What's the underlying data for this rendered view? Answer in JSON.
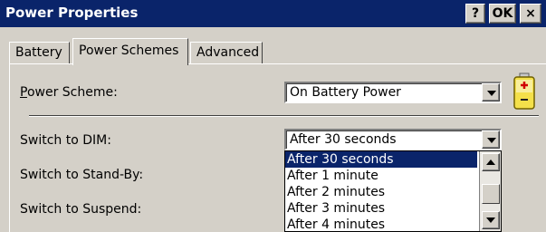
{
  "window": {
    "title": "Power Properties",
    "help_label": "?",
    "ok_label": "OK",
    "close_label": "×",
    "title_bar_color": "#0a246a"
  },
  "tabs": [
    {
      "label": "Battery",
      "active": false
    },
    {
      "label": "Power Schemes",
      "active": true
    },
    {
      "label": "Advanced",
      "active": false
    }
  ],
  "power_scheme": {
    "label_prefix": "",
    "label_accel": "P",
    "label_rest": "ower Scheme:",
    "value": "On Battery Power",
    "icon": "battery-icon"
  },
  "settings": {
    "dim_label": "Switch to DIM:",
    "dim_value": "After 30 seconds",
    "standby_label": "Switch to Stand-By:",
    "suspend_label": "Switch to Suspend:"
  },
  "dropdown": {
    "options": [
      "After 30 seconds",
      "After 1 minute",
      "After 2 minutes",
      "After 3 minutes",
      "After 4 minutes"
    ],
    "selected_index": 0
  }
}
